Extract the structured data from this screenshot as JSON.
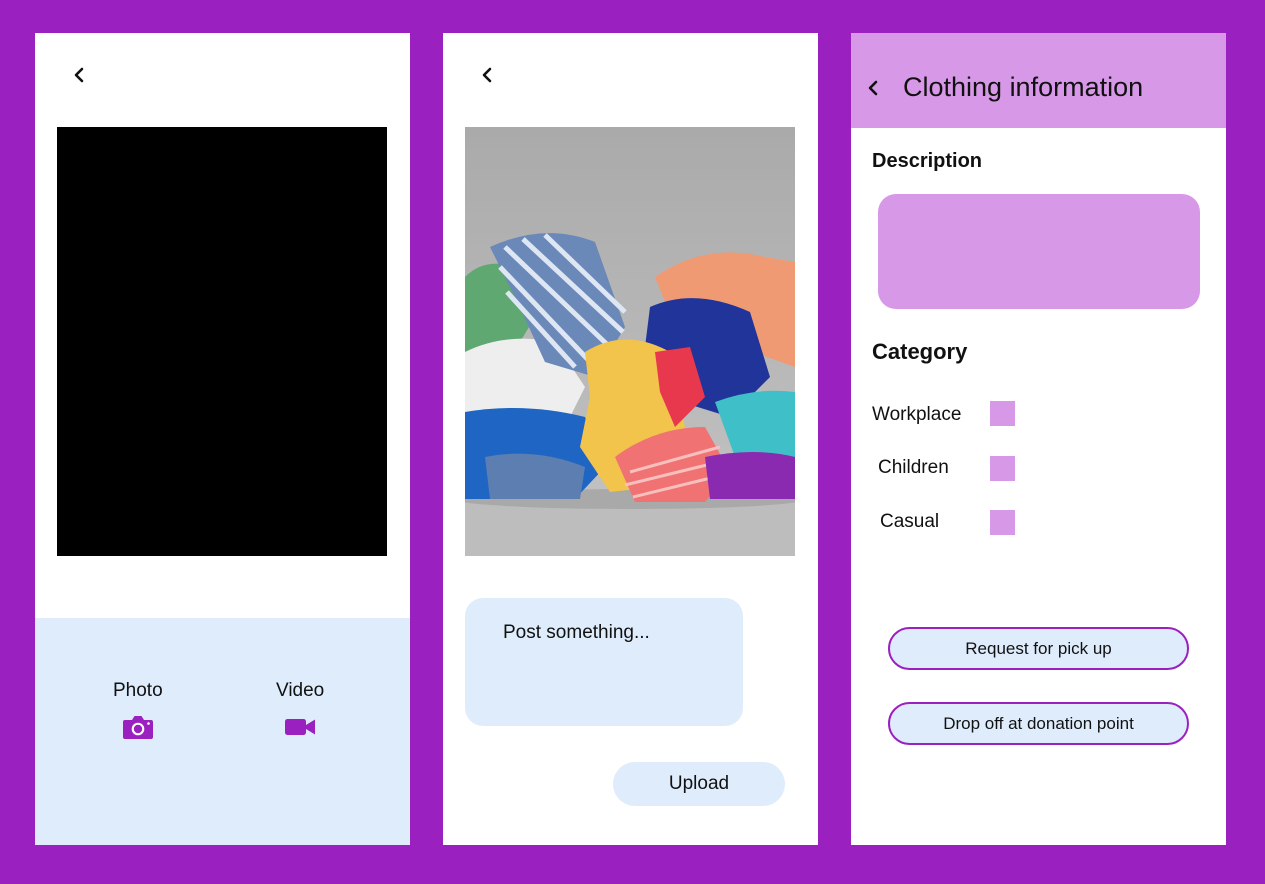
{
  "colors": {
    "background": "#9b20c0",
    "accent": "#9b20c0",
    "light_panel": "#dfecfc",
    "lilac": "#d898e8",
    "screen": "#ffffff"
  },
  "camera_screen": {
    "back_icon": "chevron-left-icon",
    "modes": [
      {
        "label": "Photo",
        "icon": "camera-icon"
      },
      {
        "label": "Video",
        "icon": "video-camera-icon"
      }
    ]
  },
  "post_screen": {
    "back_icon": "chevron-left-icon",
    "post_placeholder": "Post something...",
    "upload_label": "Upload"
  },
  "info_screen": {
    "title": "Clothing information",
    "description_label": "Description",
    "category_label": "Category",
    "categories": [
      {
        "label": "Workplace",
        "checked": false
      },
      {
        "label": "Children",
        "checked": false
      },
      {
        "label": "Casual",
        "checked": false
      }
    ],
    "actions": {
      "pickup": "Request for pick up",
      "dropoff": "Drop off at donation point"
    }
  }
}
